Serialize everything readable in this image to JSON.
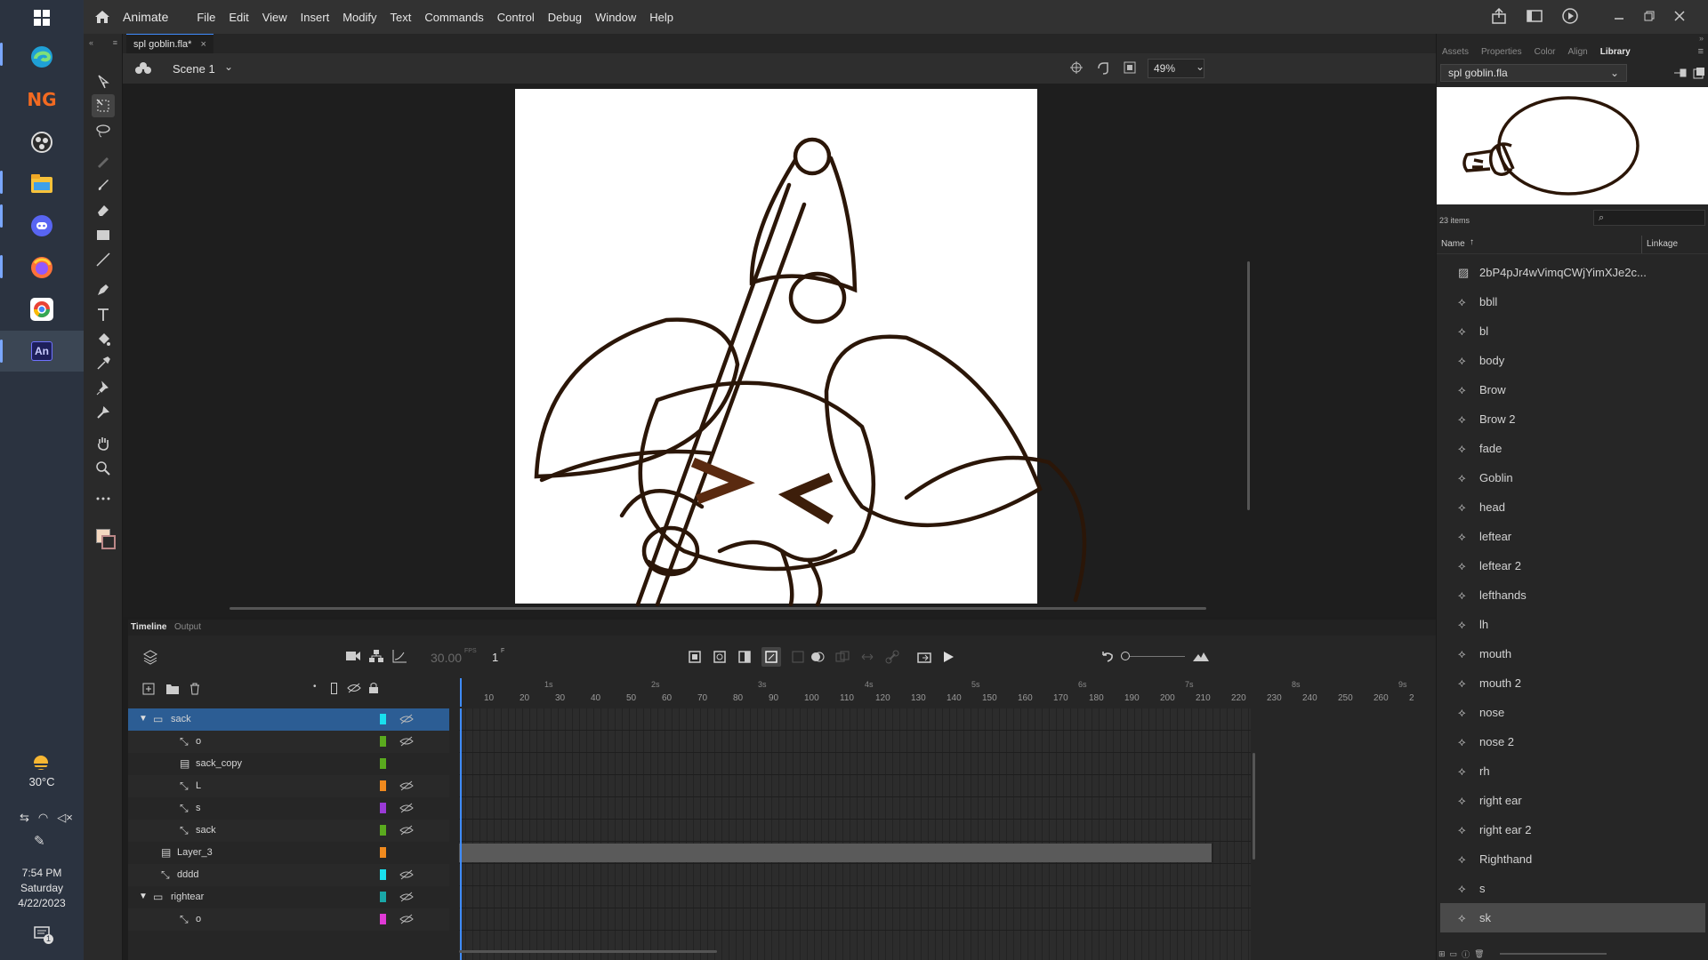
{
  "taskbar": {
    "weather": "30°C",
    "time": "7:54 PM",
    "day": "Saturday",
    "date": "4/22/2023",
    "notification_count": "1",
    "apps": [
      {
        "name": "windows-start-icon"
      },
      {
        "name": "edge-icon"
      },
      {
        "name": "newgrounds-icon",
        "label": "NG"
      },
      {
        "name": "obs-icon"
      },
      {
        "name": "file-explorer-icon"
      },
      {
        "name": "discord-icon"
      },
      {
        "name": "firefox-icon"
      },
      {
        "name": "chrome-icon"
      },
      {
        "name": "animate-icon",
        "label": "An"
      }
    ]
  },
  "app": {
    "name": "Animate",
    "menu": [
      "File",
      "Edit",
      "View",
      "Insert",
      "Modify",
      "Text",
      "Commands",
      "Control",
      "Debug",
      "Window",
      "Help"
    ]
  },
  "document": {
    "tab_title": "spl goblin.fla*",
    "close": "×",
    "scene": "Scene 1",
    "zoom": "49%"
  },
  "timeline": {
    "tabs": [
      "Timeline",
      "Output"
    ],
    "fps": "30.00",
    "fps_unit": "FPS",
    "frame": "1",
    "frame_unit": "F",
    "seconds": [
      "1s",
      "2s",
      "3s",
      "4s",
      "5s",
      "6s",
      "7s",
      "8s",
      "9s"
    ],
    "frames": [
      "10",
      "20",
      "30",
      "40",
      "50",
      "60",
      "70",
      "80",
      "90",
      "100",
      "110",
      "120",
      "130",
      "140",
      "150",
      "160",
      "170",
      "180",
      "190",
      "200",
      "210",
      "220",
      "230",
      "240",
      "250",
      "260",
      "2"
    ],
    "layers": [
      {
        "name": "sack",
        "type": "folder",
        "color": "#19e0ee",
        "selected": true,
        "expanded": true,
        "indent": 0
      },
      {
        "name": "o",
        "type": "bone",
        "color": "#5aaa1e",
        "indent": 1
      },
      {
        "name": "sack_copy",
        "type": "layer",
        "color": "#5aaa1e",
        "indent": 1
      },
      {
        "name": "L",
        "type": "bone",
        "color": "#f08a1e",
        "indent": 1
      },
      {
        "name": "s",
        "type": "bone",
        "color": "#9a3ad6",
        "indent": 1
      },
      {
        "name": "sack",
        "type": "bone",
        "color": "#5aaa1e",
        "indent": 1
      },
      {
        "name": "Layer_3",
        "type": "layer",
        "color": "#f08a1e",
        "indent": 0
      },
      {
        "name": "dddd",
        "type": "bone",
        "color": "#19e0ee",
        "indent": 0
      },
      {
        "name": "rightear",
        "type": "folder",
        "color": "#1aa8a8",
        "expanded": true,
        "indent": 0
      },
      {
        "name": "o",
        "type": "bone",
        "color": "#e03ad6",
        "indent": 1
      }
    ]
  },
  "panels": {
    "tabs": [
      "Assets",
      "Properties",
      "Color",
      "Align",
      "Library"
    ],
    "active_tab": "Library",
    "library_file": "spl goblin.fla",
    "item_count": "23 items",
    "search_placeholder": "",
    "col_name": "Name",
    "col_linkage": "Linkage",
    "items": [
      {
        "name": "2bP4pJr4wVimqCWjYimXJe2c...",
        "type": "bitmap"
      },
      {
        "name": "bbll",
        "type": "symbol"
      },
      {
        "name": "bl",
        "type": "symbol"
      },
      {
        "name": "body",
        "type": "symbol"
      },
      {
        "name": "Brow",
        "type": "symbol"
      },
      {
        "name": "Brow 2",
        "type": "symbol"
      },
      {
        "name": "fade",
        "type": "symbol"
      },
      {
        "name": "Goblin",
        "type": "symbol"
      },
      {
        "name": "head",
        "type": "symbol"
      },
      {
        "name": "leftear",
        "type": "symbol"
      },
      {
        "name": "leftear 2",
        "type": "symbol"
      },
      {
        "name": "lefthands",
        "type": "symbol"
      },
      {
        "name": "lh",
        "type": "symbol"
      },
      {
        "name": "mouth",
        "type": "symbol"
      },
      {
        "name": "mouth 2",
        "type": "symbol"
      },
      {
        "name": "nose",
        "type": "symbol"
      },
      {
        "name": "nose 2",
        "type": "symbol"
      },
      {
        "name": "rh",
        "type": "symbol"
      },
      {
        "name": "right ear",
        "type": "symbol"
      },
      {
        "name": "right ear 2",
        "type": "symbol"
      },
      {
        "name": "Righthand",
        "type": "symbol"
      },
      {
        "name": "s",
        "type": "symbol"
      },
      {
        "name": "sk",
        "type": "symbol",
        "selected": true
      }
    ]
  },
  "colors": {
    "accent_selected": "#2c5d94",
    "playhead": "#3f8cff",
    "stroke": "#2b1608"
  }
}
